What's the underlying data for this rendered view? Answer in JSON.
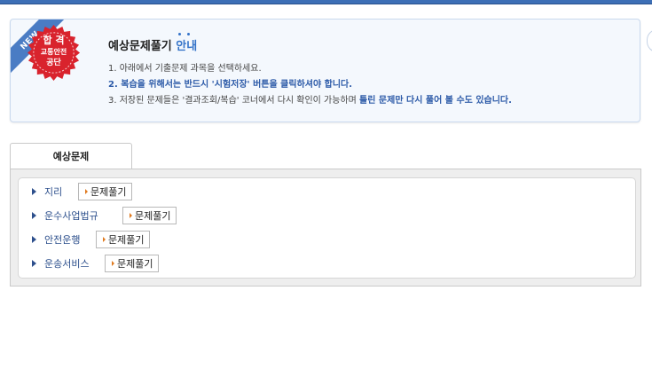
{
  "info": {
    "ribbon": "NEW",
    "badge": {
      "line1": "합 격",
      "line2": "교통안전",
      "line3": "공단"
    },
    "title_main": "예상문제풀기",
    "title_accent": "안내",
    "line1": "1. 아래에서 기출문제 과목을 선택하세요.",
    "line2": "2. 복습을 위해서는 반드시 '시험저장' 버튼을 클릭하셔야 합니다.",
    "line3_a": "3. 저장된 문제들은 '결과조회/복습' 코너에서 다시 확인이 가능하며 ",
    "line3_b": "틀린 문제만 다시 풀어 볼 수도 있습니다."
  },
  "tab": {
    "label": "예상문제"
  },
  "subjects": [
    {
      "name": "지리",
      "button": "문제풀기"
    },
    {
      "name": "운수사업법규",
      "button": "문제풀기"
    },
    {
      "name": "안전운행",
      "button": "문제풀기"
    },
    {
      "name": "운송서비스",
      "button": "문제풀기"
    }
  ],
  "colors": {
    "accent": "#3574c9",
    "badge_red": "#d9232d",
    "link": "#2c4f8c"
  },
  "icons": {
    "item_bullet": "triangle-right-icon",
    "button_bullet": "orange-arrow-icon"
  }
}
